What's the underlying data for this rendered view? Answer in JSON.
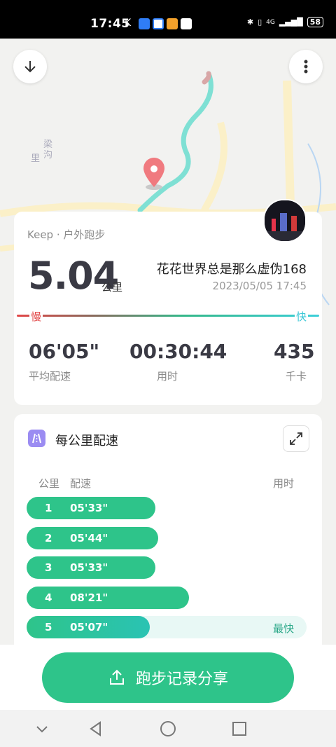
{
  "status_bar": {
    "time": "17:45",
    "carrier_glyph": "K",
    "network": "4G",
    "battery": "58",
    "icons": [
      "cloud-app-icon",
      "blue-app-icon",
      "orange-app-icon",
      "qq-icon",
      "bluetooth-icon",
      "vibrate-icon",
      "signal-icon",
      "battery-icon"
    ]
  },
  "map": {
    "labels": [
      "梁",
      "沟",
      "里"
    ],
    "route_color_start": "#d9a7a7",
    "route_color_end": "#7fe0d4"
  },
  "summary": {
    "source": "Keep · 户外跑步",
    "distance": "5.04",
    "distance_unit": "公里",
    "username": "花花世界总是那么虚伪168",
    "datetime": "2023/05/05 17:45",
    "slow_label": "慢",
    "fast_label": "快",
    "stats": [
      {
        "value": "06'05\"",
        "label": "平均配速"
      },
      {
        "value": "00:30:44",
        "label": "用时"
      },
      {
        "value": "435",
        "label": "千卡"
      }
    ]
  },
  "splits": {
    "title": "每公里配速",
    "col_km": "公里",
    "col_pace": "配速",
    "col_time": "用时",
    "rows": [
      {
        "km": "1",
        "pace": "05'33\"",
        "fraction": 0.46,
        "badge": ""
      },
      {
        "km": "2",
        "pace": "05'44\"",
        "fraction": 0.47,
        "badge": ""
      },
      {
        "km": "3",
        "pace": "05'33\"",
        "fraction": 0.46,
        "badge": ""
      },
      {
        "km": "4",
        "pace": "08'21\"",
        "fraction": 0.58,
        "badge": ""
      },
      {
        "km": "5",
        "pace": "05'07\"",
        "fraction": 0.44,
        "badge": "最快"
      }
    ]
  },
  "share_button": {
    "label": "跑步记录分享"
  },
  "colors": {
    "accent": "#2ec48a",
    "slow": "#e24848",
    "fast": "#38c7d6"
  }
}
